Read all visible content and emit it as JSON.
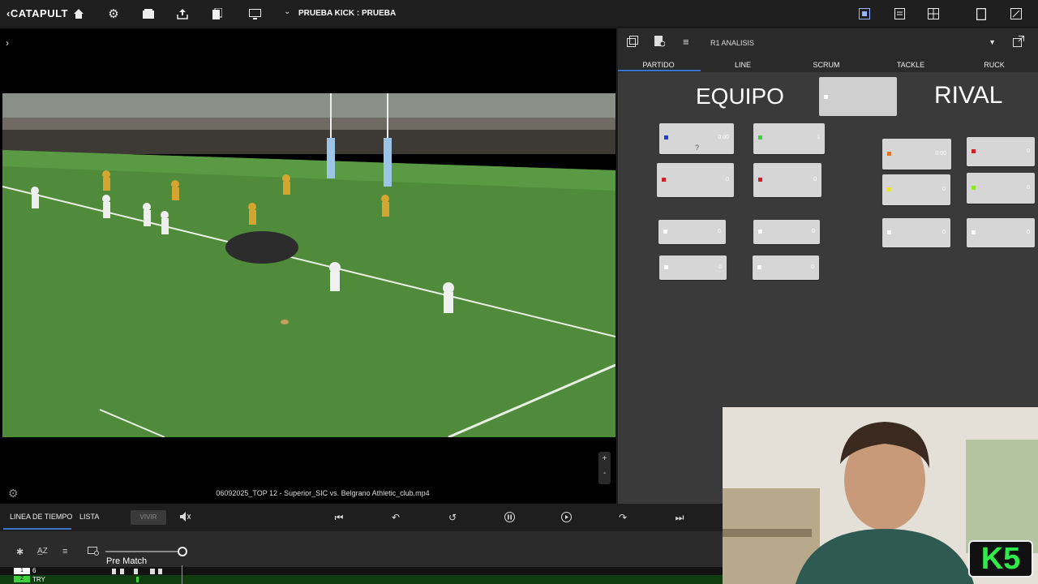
{
  "topbar": {
    "brand": "CATAPULT",
    "project_title": "PRUEBA KICK : PRUEBA",
    "icons": [
      "home-icon",
      "gear-icon",
      "folder-icon",
      "upload-icon",
      "bookmarks-icon",
      "monitor-icon",
      "layout-icon",
      "document-icon",
      "grid-icon",
      "tablet-icon",
      "expand-icon"
    ]
  },
  "video": {
    "filename": "06092025_TOP 12 - Superior_SIC vs. Belgrano Athletic_club.mp4",
    "zoom_plus": "+",
    "zoom_minus": "-"
  },
  "panel": {
    "selected": "R1 ANALISIS",
    "tabs": [
      "PARTIDO",
      "LINE",
      "SCRUM",
      "TACKLE",
      "RUCK"
    ],
    "active_tab": "PARTIDO",
    "equipo_title": "EQUIPO",
    "rival_title": "RIVAL",
    "equipo_cards": [
      {
        "color": "#1f3fd0",
        "value": "0:00",
        "extra": "?"
      },
      {
        "color": "#3ecf3e",
        "value": "1"
      },
      {
        "color": "#d0202a",
        "value": "0"
      },
      {
        "color": "#d0202a",
        "value": "0"
      },
      {
        "color": "#ffffff",
        "value": "0"
      },
      {
        "color": "#ffffff",
        "value": "0"
      },
      {
        "color": "#ffffff",
        "value": "0"
      },
      {
        "color": "#ffffff",
        "value": "0"
      }
    ],
    "rival_cards": [
      {
        "color": "#e8742a",
        "value": "0:00"
      },
      {
        "color": "#d0202a",
        "value": "0"
      },
      {
        "color": "#e6e62a",
        "value": "0"
      },
      {
        "color": "#8ee82a",
        "value": "0"
      },
      {
        "color": "#ffffff",
        "value": "0"
      },
      {
        "color": "#ffffff",
        "value": "0"
      }
    ]
  },
  "bottom": {
    "tab_timeline": "LINEA DE TIEMPO",
    "tab_list": "LISTA",
    "live_button": "VIVIR",
    "slider_label": "Pre Match",
    "rows": [
      {
        "num": "1",
        "label": "6"
      },
      {
        "num": "2",
        "label": "TRY"
      }
    ]
  },
  "webcam": {
    "logo_text": "K5"
  }
}
